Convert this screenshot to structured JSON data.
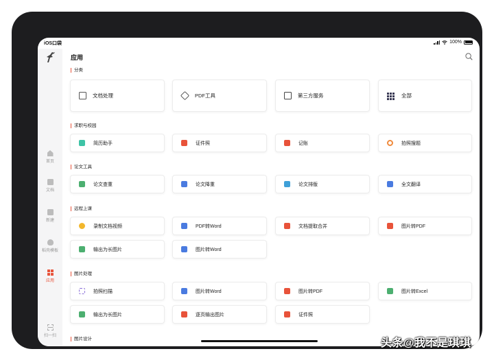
{
  "statusbar": {
    "time": "iOS口袋",
    "battery": "100%"
  },
  "sidebar": {
    "items": [
      {
        "label": "首页",
        "active": false
      },
      {
        "label": "文档",
        "active": false
      },
      {
        "label": "新建",
        "active": false
      },
      {
        "label": "稻壳模板",
        "active": false
      },
      {
        "label": "应用",
        "active": true
      }
    ],
    "scan_label": "扫一扫"
  },
  "header": {
    "title": "应用"
  },
  "categories": {
    "title": "分类",
    "items": [
      {
        "label": "文档处理",
        "icon": "document-icon"
      },
      {
        "label": "PDF工具",
        "icon": "pdf-tool-icon"
      },
      {
        "label": "第三方服务",
        "icon": "third-party-icon"
      },
      {
        "label": "全部",
        "icon": "grid-icon"
      }
    ]
  },
  "sections": [
    {
      "title": "求职与校园",
      "items": [
        {
          "label": "简历助手",
          "color": "#3ec3a6"
        },
        {
          "label": "证件照",
          "color": "#e8533a"
        },
        {
          "label": "记账",
          "color": "#e8533a"
        },
        {
          "label": "拍照搜题",
          "color": "#f08a3c"
        }
      ]
    },
    {
      "title": "论文工具",
      "items": [
        {
          "label": "论文查重",
          "color": "#4caf70"
        },
        {
          "label": "论文降重",
          "color": "#4a7be0"
        },
        {
          "label": "论文排版",
          "color": "#3fa0d8"
        },
        {
          "label": "全文翻译",
          "color": "#4a7be0"
        }
      ]
    },
    {
      "title": "远程上课",
      "items": [
        {
          "label": "录制文档视频",
          "color": "#f2b72c"
        },
        {
          "label": "PDF转Word",
          "color": "#4a7be0"
        },
        {
          "label": "文档提取合并",
          "color": "#e8533a"
        },
        {
          "label": "图片转PDF",
          "color": "#e8533a"
        },
        {
          "label": "输出为长图片",
          "color": "#4caf70"
        },
        {
          "label": "图片转Word",
          "color": "#4a7be0"
        }
      ]
    },
    {
      "title": "图片处理",
      "items": [
        {
          "label": "拍照扫描",
          "color": "#8a6fd8"
        },
        {
          "label": "图片转Word",
          "color": "#4a7be0"
        },
        {
          "label": "图片转PDF",
          "color": "#e8533a"
        },
        {
          "label": "图片转Excel",
          "color": "#4caf70"
        },
        {
          "label": "输出为长图片",
          "color": "#4caf70"
        },
        {
          "label": "逐页输出图片",
          "color": "#e8533a"
        },
        {
          "label": "证件照",
          "color": "#e8533a"
        }
      ]
    },
    {
      "title": "图片设计",
      "items": []
    }
  ],
  "watermark": "头条@我不是琪琪"
}
